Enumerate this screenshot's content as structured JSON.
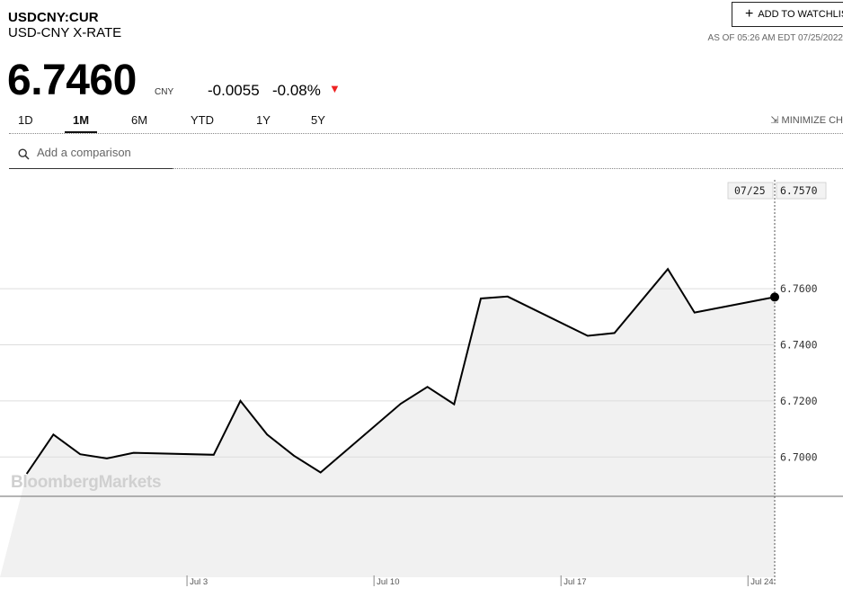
{
  "header": {
    "ticker": "USDCNY:CUR",
    "name": "USD-CNY X-RATE",
    "watchlist_label": "ADD TO WATCHLIS",
    "as_of": "AS OF 05:26 AM EDT 07/25/2022"
  },
  "quote": {
    "price": "6.7460",
    "unit": "CNY",
    "change": "-0.0055",
    "change_pct": "-0.08%",
    "direction_icon": "down-triangle-icon",
    "down_color": "#e22222"
  },
  "tabs": [
    {
      "label": "1D",
      "active": false
    },
    {
      "label": "1M",
      "active": true
    },
    {
      "label": "6M",
      "active": false
    },
    {
      "label": "YTD",
      "active": false
    },
    {
      "label": "1Y",
      "active": false
    },
    {
      "label": "5Y",
      "active": false
    }
  ],
  "minimize_label": "MINIMIZE CH",
  "compare": {
    "placeholder": "Add a comparison"
  },
  "watermark": "BloombergMarkets",
  "chart_data": {
    "type": "area",
    "series": [
      {
        "values": [
          {
            "x": "2022-06-27",
            "y": 6.694
          },
          {
            "x": "2022-06-28",
            "y": 6.708
          },
          {
            "x": "2022-06-29",
            "y": 6.701
          },
          {
            "x": "2022-06-30",
            "y": 6.6995
          },
          {
            "x": "2022-07-01",
            "y": 6.7015
          },
          {
            "x": "2022-07-04",
            "y": 6.7008
          },
          {
            "x": "2022-07-05",
            "y": 6.72
          },
          {
            "x": "2022-07-06",
            "y": 6.708
          },
          {
            "x": "2022-07-07",
            "y": 6.7005
          },
          {
            "x": "2022-07-08",
            "y": 6.6945
          },
          {
            "x": "2022-07-11",
            "y": 6.719
          },
          {
            "x": "2022-07-12",
            "y": 6.725
          },
          {
            "x": "2022-07-13",
            "y": 6.7188
          },
          {
            "x": "2022-07-14",
            "y": 6.7565
          },
          {
            "x": "2022-07-15",
            "y": 6.7572
          },
          {
            "x": "2022-07-18",
            "y": 6.7432
          },
          {
            "x": "2022-07-19",
            "y": 6.7442
          },
          {
            "x": "2022-07-21",
            "y": 6.767
          },
          {
            "x": "2022-07-22",
            "y": 6.7515
          },
          {
            "x": "2022-07-25",
            "y": 6.757
          }
        ]
      }
    ],
    "y_ticks": [
      "6.7000",
      "6.7200",
      "6.7400",
      "6.7600"
    ],
    "x_ticks": [
      {
        "date": "2022-07-03",
        "label": "Jul 3"
      },
      {
        "date": "2022-07-10",
        "label": "Jul 10"
      },
      {
        "date": "2022-07-17",
        "label": "Jul 17"
      },
      {
        "date": "2022-07-24",
        "label": "Jul 24"
      }
    ],
    "cursor": {
      "date_label": "07/25",
      "value_label": "6.7570"
    },
    "ylim": [
      6.686,
      6.802
    ],
    "xlim": [
      "2022-06-26",
      "2022-07-25"
    ],
    "grid": true,
    "line_color": "#000000",
    "fill_color": "#f1f1f1",
    "grid_color": "#dddddd"
  }
}
